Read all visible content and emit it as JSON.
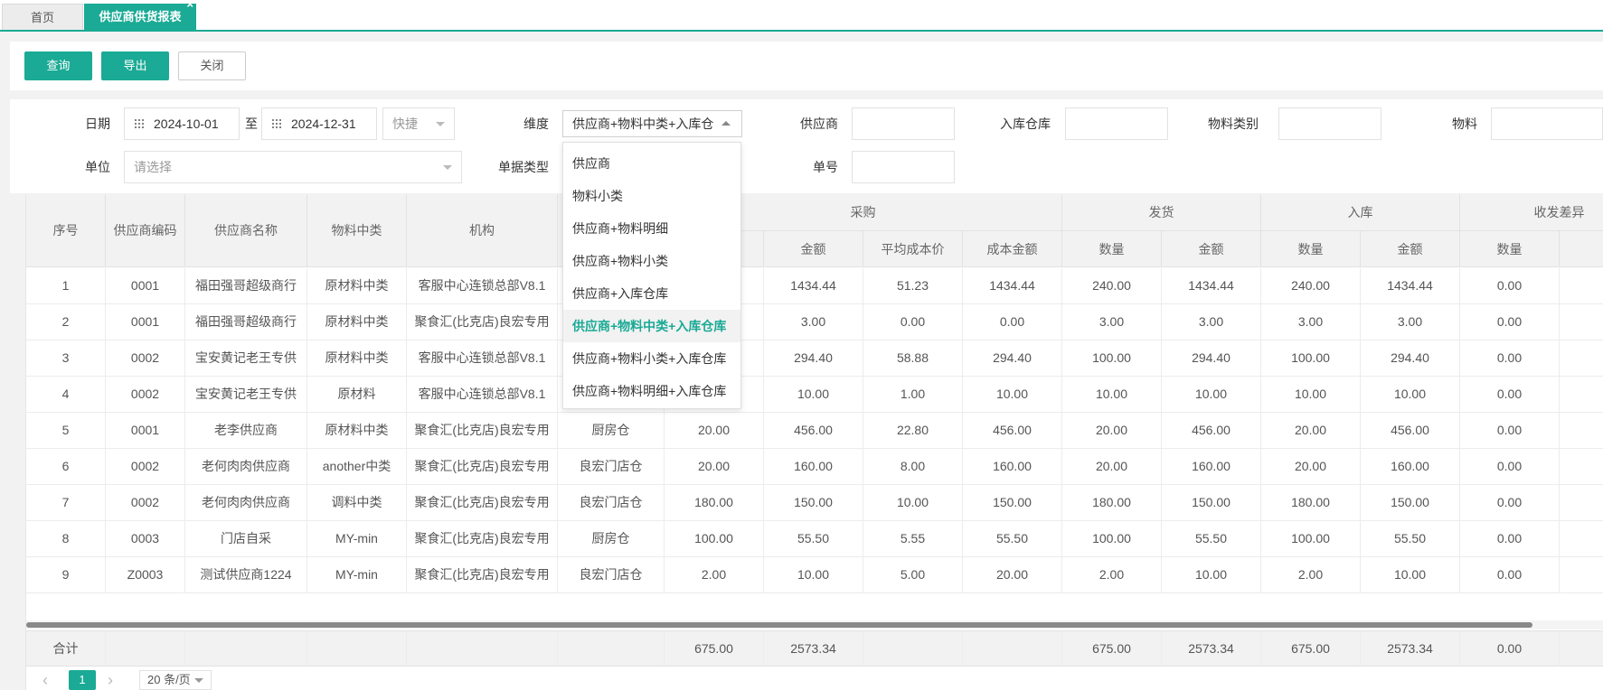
{
  "tabs": {
    "home": "首页",
    "active": "供应商供货报表",
    "close_glyph": "×"
  },
  "toolbar": {
    "query": "查询",
    "export": "导出",
    "close": "关闭"
  },
  "filters": {
    "date_label": "日期",
    "date_from": "2024-10-01",
    "to_label": "至",
    "date_to": "2024-12-31",
    "quick": "快捷",
    "dimension_label": "维度",
    "dimension_value": "供应商+物料中类+入库仓",
    "supplier_label": "供应商",
    "warehouse_label": "入库仓库",
    "category_label": "物料类别",
    "material_label": "物料",
    "unit_label": "单位",
    "unit_placeholder": "请选择",
    "doc_type_label": "单据类型",
    "doc_no_label": "单号"
  },
  "dropdown": {
    "items": [
      "供应商",
      "物料小类",
      "供应商+物料明细",
      "供应商+物料小类",
      "供应商+入库仓库",
      "供应商+物料中类+入库仓库",
      "供应商+物料小类+入库仓库",
      "供应商+物料明细+入库仓库"
    ],
    "selected_index": 5
  },
  "table": {
    "group_headers": {
      "purchase": "采购",
      "shipment": "发货",
      "inbound": "入库",
      "diff": "收发差异"
    },
    "headers": {
      "seq": "序号",
      "supplier_code": "供应商编码",
      "supplier_name": "供应商名称",
      "mid_category": "物料中类",
      "org": "机构",
      "amount": "金额",
      "avg_cost": "平均成本价",
      "cost_amount": "成本金额",
      "qty": "数量"
    },
    "rows": [
      [
        "1",
        "0001",
        "福田强哥超级商行",
        "原材料中类",
        "客服中心连锁总部V8.1",
        "",
        "",
        "1434.44",
        "51.23",
        "1434.44",
        "240.00",
        "1434.44",
        "240.00",
        "1434.44",
        "0.00"
      ],
      [
        "2",
        "0001",
        "福田强哥超级商行",
        "原材料中类",
        "聚食汇(比克店)良宏专用",
        "",
        "",
        "3.00",
        "0.00",
        "0.00",
        "3.00",
        "3.00",
        "3.00",
        "3.00",
        "0.00"
      ],
      [
        "3",
        "0002",
        "宝安黄记老王专供",
        "原材料中类",
        "客服中心连锁总部V8.1",
        "",
        "",
        "294.40",
        "58.88",
        "294.40",
        "100.00",
        "294.40",
        "100.00",
        "294.40",
        "0.00"
      ],
      [
        "4",
        "0002",
        "宝安黄记老王专供",
        "原材料",
        "客服中心连锁总部V8.1",
        "",
        "",
        "10.00",
        "1.00",
        "10.00",
        "10.00",
        "10.00",
        "10.00",
        "10.00",
        "0.00"
      ],
      [
        "5",
        "0001",
        "老李供应商",
        "原材料中类",
        "聚食汇(比克店)良宏专用",
        "厨房仓",
        "20.00",
        "456.00",
        "22.80",
        "456.00",
        "20.00",
        "456.00",
        "20.00",
        "456.00",
        "0.00"
      ],
      [
        "6",
        "0002",
        "老何肉肉供应商",
        "another中类",
        "聚食汇(比克店)良宏专用",
        "良宏门店仓",
        "20.00",
        "160.00",
        "8.00",
        "160.00",
        "20.00",
        "160.00",
        "20.00",
        "160.00",
        "0.00"
      ],
      [
        "7",
        "0002",
        "老何肉肉供应商",
        "调料中类",
        "聚食汇(比克店)良宏专用",
        "良宏门店仓",
        "180.00",
        "150.00",
        "10.00",
        "150.00",
        "180.00",
        "150.00",
        "180.00",
        "150.00",
        "0.00"
      ],
      [
        "8",
        "0003",
        "门店自采",
        "MY-min",
        "聚食汇(比克店)良宏专用",
        "厨房仓",
        "100.00",
        "55.50",
        "5.55",
        "55.50",
        "100.00",
        "55.50",
        "100.00",
        "55.50",
        "0.00"
      ],
      [
        "9",
        "Z0003",
        "测试供应商1224",
        "MY-min",
        "聚食汇(比克店)良宏专用",
        "良宏门店仓",
        "2.00",
        "10.00",
        "5.00",
        "20.00",
        "2.00",
        "10.00",
        "2.00",
        "10.00",
        "0.00"
      ]
    ],
    "totals": [
      "合计",
      "",
      "",
      "",
      "",
      "",
      "675.00",
      "2573.34",
      "",
      "",
      "675.00",
      "2573.34",
      "675.00",
      "2573.34",
      "0.00"
    ]
  },
  "pager": {
    "prev": "‹",
    "next": "›",
    "current": "1",
    "page_size": "20 条/页"
  }
}
